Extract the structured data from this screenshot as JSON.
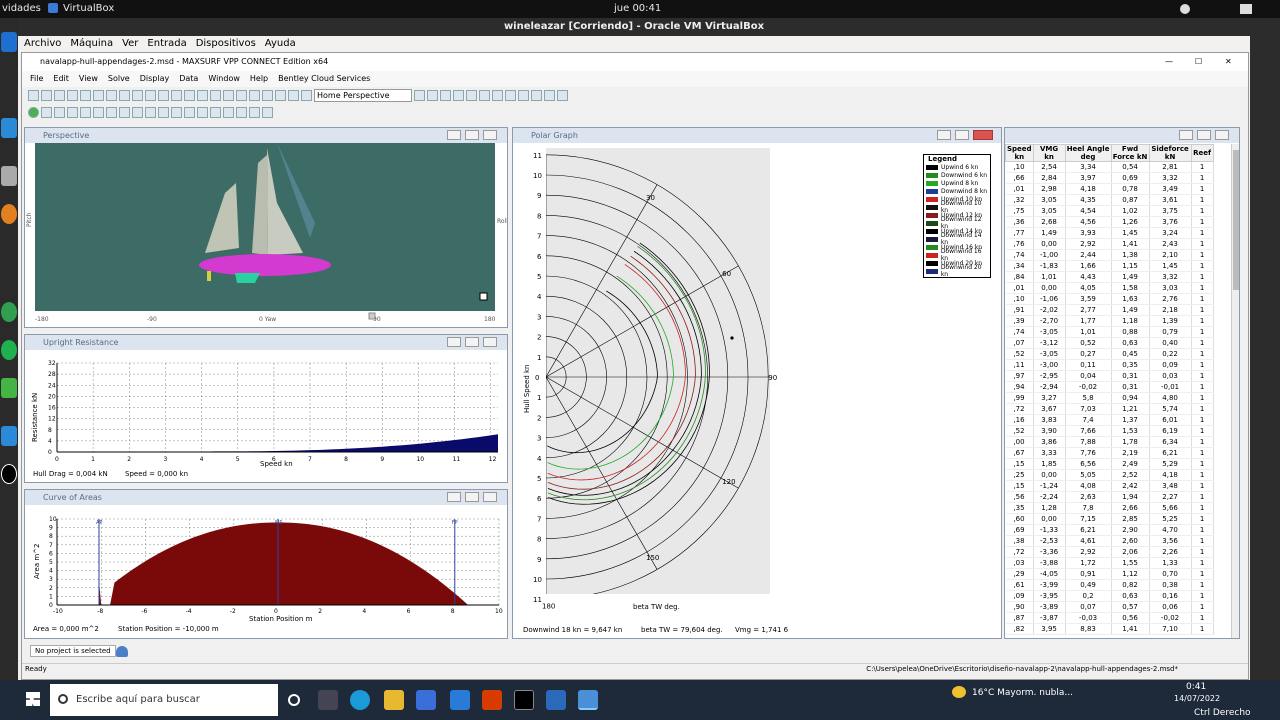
{
  "gnome": {
    "activities": "vidades",
    "app": "VirtualBox",
    "clock": "jue 00:41"
  },
  "vbox": {
    "title": "wineleazar [Corriendo] - Oracle VM VirtualBox",
    "menu": [
      "Archivo",
      "Máquina",
      "Ver",
      "Entrada",
      "Dispositivos",
      "Ayuda"
    ]
  },
  "maxsurf": {
    "title": "navalapp-hull-appendages-2.msd - MAXSURF VPP CONNECT Edition x64",
    "menu": [
      "File",
      "Edit",
      "View",
      "Solve",
      "Display",
      "Data",
      "Window",
      "Help",
      "Bentley Cloud Services"
    ],
    "view_select": "Home Perspective"
  },
  "perspective": {
    "title": "Perspective",
    "ticks_x": [
      "-180",
      "-90",
      "0 Yaw",
      "90",
      "180"
    ],
    "left_label": "Pitch"
  },
  "resistance": {
    "title": "Upright Resistance",
    "ylabel": "Resistance  kN",
    "xlabel": "Speed  kn",
    "status_drag": "Hull Drag =  0,004 kN",
    "status_speed": "Speed =  0,000 kn"
  },
  "areas": {
    "title": "Curve of Areas",
    "ylabel": "Area  m^2",
    "xlabel": "Station Position  m",
    "status_area": "Area =  0,000 m^2",
    "status_station": "Station Position =  -10,000 m",
    "markers": [
      "AP",
      "MS",
      "FP"
    ]
  },
  "polar": {
    "title": "Polar Graph",
    "ylabel": "Hull Speed  kn",
    "xlabel": "beta TW  deg.",
    "status_dw": "Downwind 18 kn =  9,647 kn",
    "status_beta": "beta TW =  79,604 deg.",
    "status_vmg": "Vmg =   1,741  6",
    "angle_labels": [
      "30",
      "60",
      "90",
      "120",
      "150",
      "180"
    ],
    "legend_title": "Legend",
    "legend": [
      {
        "label": "Upwind 6 kn",
        "color": "#000000"
      },
      {
        "label": "Downwind 6 kn",
        "color": "#228b22"
      },
      {
        "label": "Upwind 8 kn",
        "color": "#22aa22"
      },
      {
        "label": "Downwind 8 kn",
        "color": "#1e3c9a"
      },
      {
        "label": "Upwind 10 kn",
        "color": "#cc2222"
      },
      {
        "label": "Downwind 10 kn",
        "color": "#111111"
      },
      {
        "label": "Upwind 12 kn",
        "color": "#8b1a1a"
      },
      {
        "label": "Downwind 12 kn",
        "color": "#1a4a1a"
      },
      {
        "label": "Upwind 14 kn",
        "color": "#000000"
      },
      {
        "label": "Downwind 14 kn",
        "color": "#1a1a40"
      },
      {
        "label": "Upwind 16 kn",
        "color": "#228b22"
      },
      {
        "label": "Downwind 16 kn",
        "color": "#cc2222"
      },
      {
        "label": "Upwind 20 kn",
        "color": "#000000"
      },
      {
        "label": "Downwind 20 kn",
        "color": "#1e2a7a"
      }
    ]
  },
  "table": {
    "headers": [
      "Speed kn",
      "VMG kn",
      "Heel Angle deg",
      "Fwd Force kN",
      "Sideforce kN",
      "Reef"
    ],
    "rows": [
      [
        ",10",
        "2,54",
        "3,34",
        "0,54",
        "2,81",
        "1"
      ],
      [
        ",66",
        "2,84",
        "3,97",
        "0,69",
        "3,32",
        "1"
      ],
      [
        ",01",
        "2,98",
        "4,18",
        "0,78",
        "3,49",
        "1"
      ],
      [
        ",32",
        "3,05",
        "4,35",
        "0,87",
        "3,61",
        "1"
      ],
      [
        ",75",
        "3,05",
        "4,54",
        "1,02",
        "3,75",
        "1"
      ],
      [
        ",36",
        "2,68",
        "4,56",
        "1,26",
        "3,76",
        "1"
      ],
      [
        ",77",
        "1,49",
        "3,93",
        "1,45",
        "3,24",
        "1"
      ],
      [
        ",76",
        "0,00",
        "2,92",
        "1,41",
        "2,43",
        "1"
      ],
      [
        ",74",
        "-1,00",
        "2,44",
        "1,38",
        "2,10",
        "1"
      ],
      [
        ",34",
        "-1,83",
        "1,66",
        "1,15",
        "1,45",
        "1"
      ],
      [
        ",84",
        "1,01",
        "4,43",
        "1,49",
        "3,32",
        "1"
      ],
      [
        ",01",
        "0,00",
        "4,05",
        "1,58",
        "3,03",
        "1"
      ],
      [
        ",10",
        "-1,06",
        "3,59",
        "1,63",
        "2,76",
        "1"
      ],
      [
        ",91",
        "-2,02",
        "2,77",
        "1,49",
        "2,18",
        "1"
      ],
      [
        ",39",
        "-2,70",
        "1,77",
        "1,18",
        "1,39",
        "1"
      ],
      [
        ",74",
        "-3,05",
        "1,01",
        "0,88",
        "0,79",
        "1"
      ],
      [
        ",07",
        "-3,12",
        "0,52",
        "0,63",
        "0,40",
        "1"
      ],
      [
        ",52",
        "-3,05",
        "0,27",
        "0,45",
        "0,22",
        "1"
      ],
      [
        ",11",
        "-3,00",
        "0,11",
        "0,35",
        "0,09",
        "1"
      ],
      [
        ",97",
        "-2,95",
        "0,04",
        "0,31",
        "0,03",
        "1"
      ],
      [
        ",94",
        "-2,94",
        "-0,02",
        "0,31",
        "-0,01",
        "1"
      ],
      [
        ",99",
        "3,27",
        "5,8",
        "0,94",
        "4,80",
        "1"
      ],
      [
        ",72",
        "3,67",
        "7,03",
        "1,21",
        "5,74",
        "1"
      ],
      [
        ",16",
        "3,83",
        "7,4",
        "1,37",
        "6,01",
        "1"
      ],
      [
        ",52",
        "3,90",
        "7,66",
        "1,53",
        "6,19",
        "1"
      ],
      [
        ",00",
        "3,86",
        "7,88",
        "1,78",
        "6,34",
        "1"
      ],
      [
        ",67",
        "3,33",
        "7,76",
        "2,19",
        "6,21",
        "1"
      ],
      [
        ",15",
        "1,85",
        "6,56",
        "2,49",
        "5,29",
        "1"
      ],
      [
        ",25",
        "0,00",
        "5,05",
        "2,52",
        "4,18",
        "1"
      ],
      [
        ",15",
        "-1,24",
        "4,08",
        "2,42",
        "3,48",
        "1"
      ],
      [
        ",56",
        "-2,24",
        "2,63",
        "1,94",
        "2,27",
        "1"
      ],
      [
        ",35",
        "1,28",
        "7,8",
        "2,66",
        "5,66",
        "1"
      ],
      [
        ",60",
        "0,00",
        "7,15",
        "2,85",
        "5,25",
        "1"
      ],
      [
        ",69",
        "-1,33",
        "6,21",
        "2,90",
        "4,70",
        "1"
      ],
      [
        ",38",
        "-2,53",
        "4,61",
        "2,60",
        "3,56",
        "1"
      ],
      [
        ",72",
        "-3,36",
        "2,92",
        "2,06",
        "2,26",
        "1"
      ],
      [
        ",03",
        "-3,88",
        "1,72",
        "1,55",
        "1,33",
        "1"
      ],
      [
        ",29",
        "-4,05",
        "0,91",
        "1,12",
        "0,70",
        "1"
      ],
      [
        ",61",
        "-3,99",
        "0,49",
        "0,82",
        "0,38",
        "1"
      ],
      [
        ",09",
        "-3,95",
        "0,2",
        "0,63",
        "0,16",
        "1"
      ],
      [
        ",90",
        "-3,89",
        "0,07",
        "0,57",
        "0,06",
        "1"
      ],
      [
        ",87",
        "-3,87",
        "-0,03",
        "0,56",
        "-0,02",
        "1"
      ],
      [
        ",82",
        "3,95",
        "8,83",
        "1,41",
        "7,10",
        "1"
      ]
    ]
  },
  "status": {
    "project": "No project is selected",
    "ready": "Ready",
    "path": "C:\\Users\\pelea\\OneDrive\\Escritorio\\diseño-navalapp-2\\navalapp-hull-appendages-2.msd*"
  },
  "taskbar": {
    "search": "Escribe aquí para buscar",
    "weather": "16°C  Mayorm. nubla...",
    "time": "0:41",
    "date": "14/07/2022",
    "host": "Ctrl Derecho"
  }
}
